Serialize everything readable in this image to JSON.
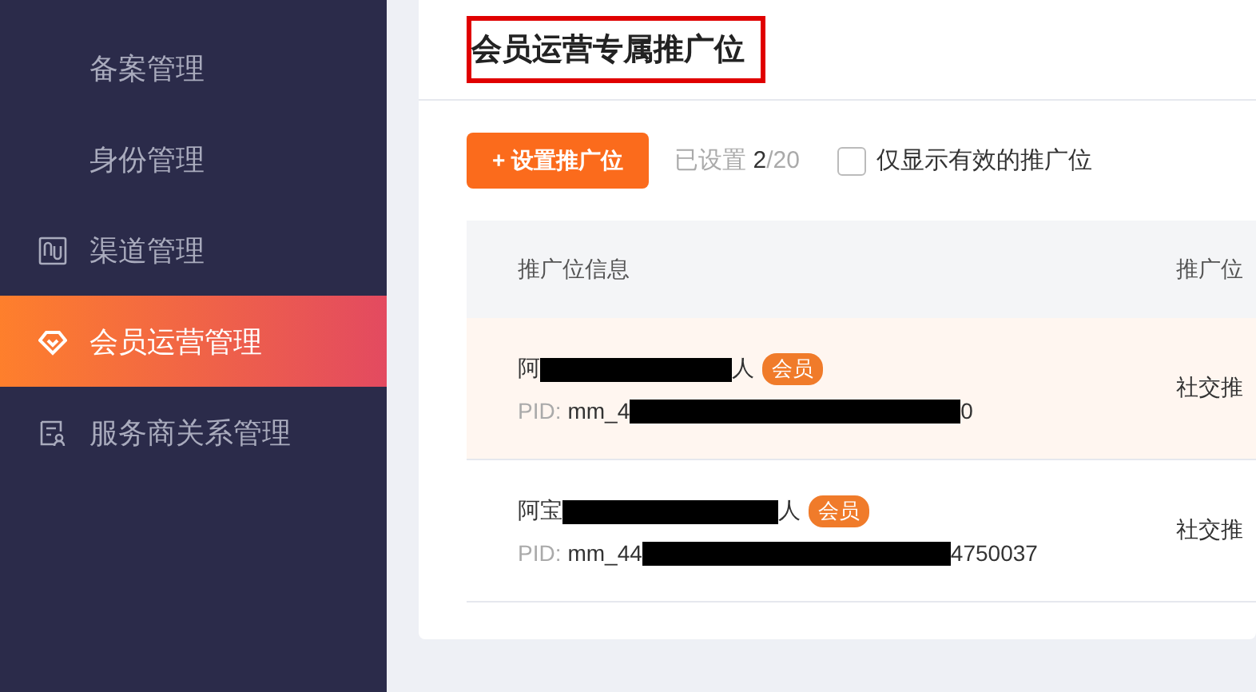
{
  "sidebar": {
    "items": [
      {
        "label": "备案管理",
        "selected": false
      },
      {
        "label": "身份管理",
        "selected": false
      },
      {
        "label": "渠道管理",
        "selected": false
      },
      {
        "label": "会员运营管理",
        "selected": true
      },
      {
        "label": "服务商关系管理",
        "selected": false
      }
    ]
  },
  "page_title": "会员运营专属推广位",
  "toolbar": {
    "add_button": "+ 设置推广位",
    "count_label": "已设置",
    "count_used": "2",
    "count_total": "/20",
    "filter": {
      "label": "仅显示有效的推广位",
      "checked": false
    }
  },
  "table": {
    "columns": [
      "推广位信息",
      "推广位"
    ],
    "rows": [
      {
        "name_start": "阿",
        "name_end": "人",
        "tag": "会员",
        "pid_label": "PID:",
        "pid_start": "mm_4",
        "pid_end": "0",
        "type": "社交推",
        "selected": true
      },
      {
        "name_start": "阿宝",
        "name_end": "人",
        "tag": "会员",
        "pid_label": "PID:",
        "pid_start": "mm_44",
        "pid_end": "4750037",
        "type": "社交推",
        "selected": false
      }
    ]
  }
}
